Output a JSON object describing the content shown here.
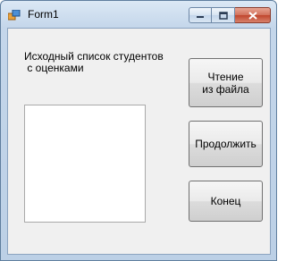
{
  "window": {
    "title": "Form1",
    "min_glyph": "▭",
    "max_glyph": "□",
    "close_glyph": "✕"
  },
  "label": {
    "text": "Исходный список студентов\n с оценками"
  },
  "buttons": {
    "read_file": "Чтение\nиз файла",
    "continue": "Продолжить",
    "end": "Конец"
  },
  "colors": {
    "client_bg": "#f0f0f0",
    "close_button": "#c0452c"
  }
}
